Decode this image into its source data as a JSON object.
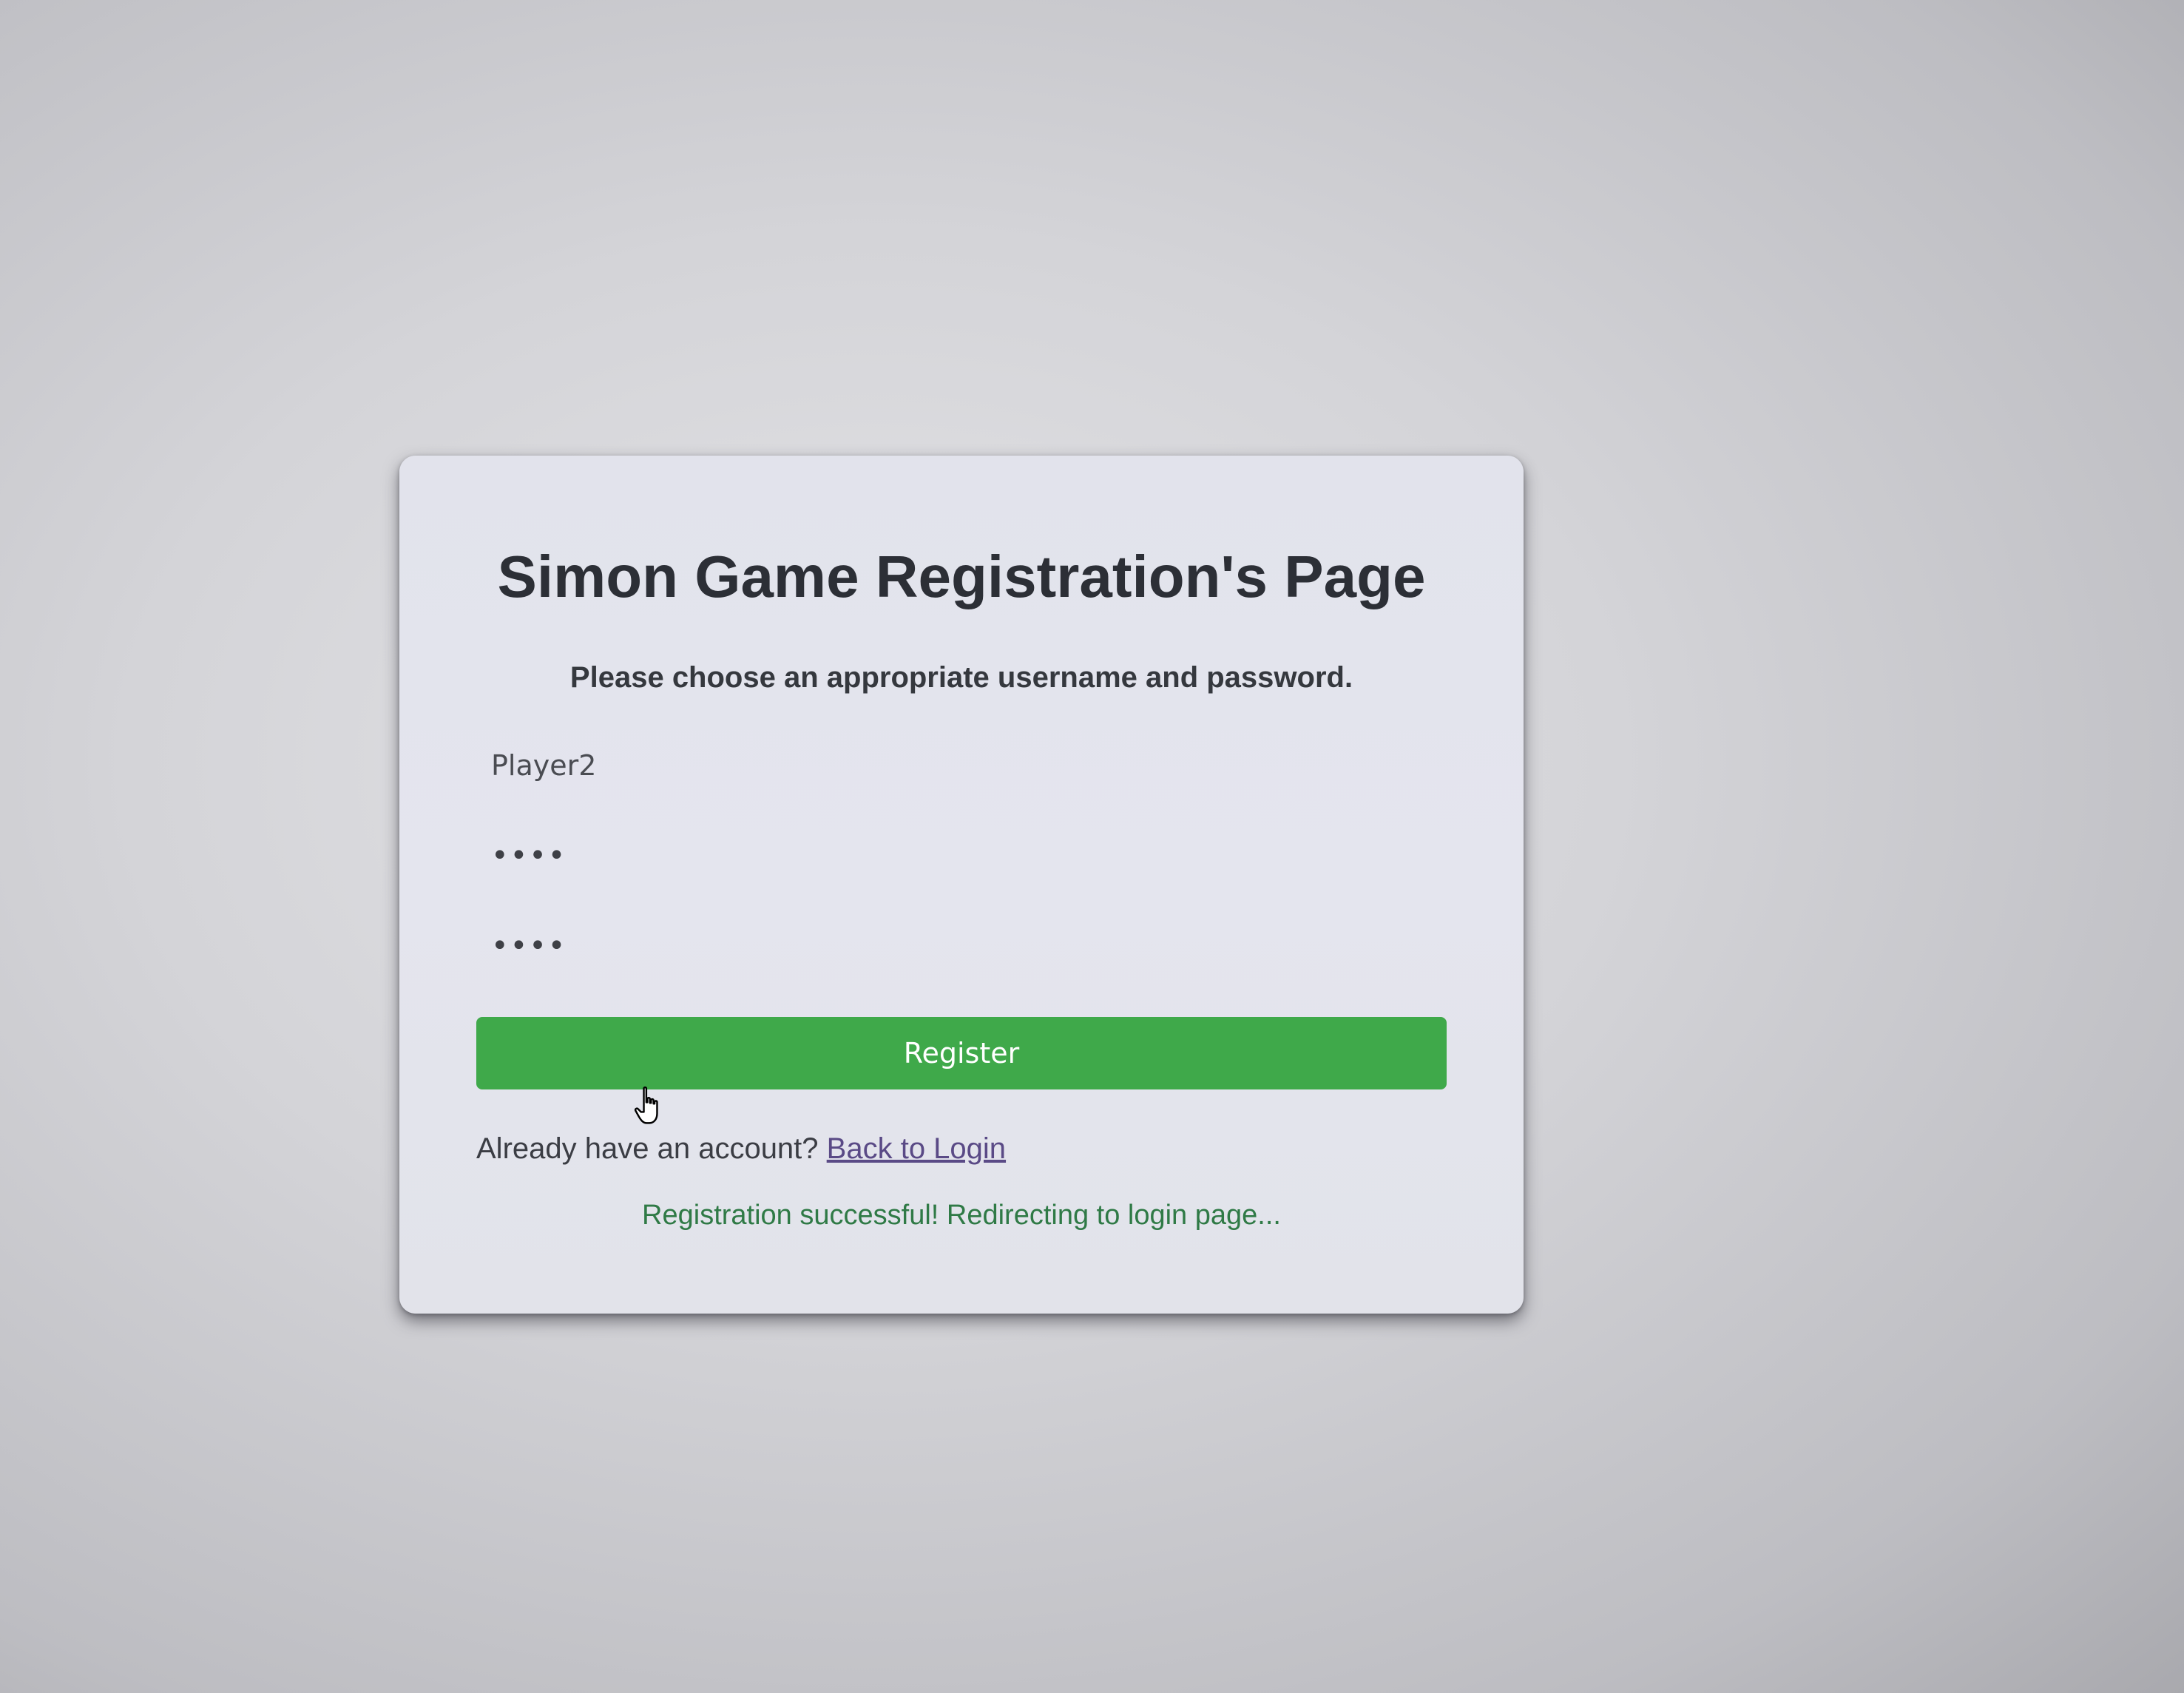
{
  "page": {
    "title": "Simon Game Registration's Page",
    "subtitle": "Please choose an appropriate username and password."
  },
  "form": {
    "username_value": "Player2",
    "password_value": "••••",
    "confirm_value": "••••",
    "register_label": "Register"
  },
  "footer": {
    "account_prompt": "Already have an account?",
    "login_link": "Back to Login",
    "status_message": "Registration successful! Redirecting to login page..."
  },
  "colors": {
    "button": "#3fa94a",
    "success_text": "#2f7a46",
    "link": "#5a4a86"
  },
  "icons": {
    "cursor": "hand-pointer-icon"
  }
}
